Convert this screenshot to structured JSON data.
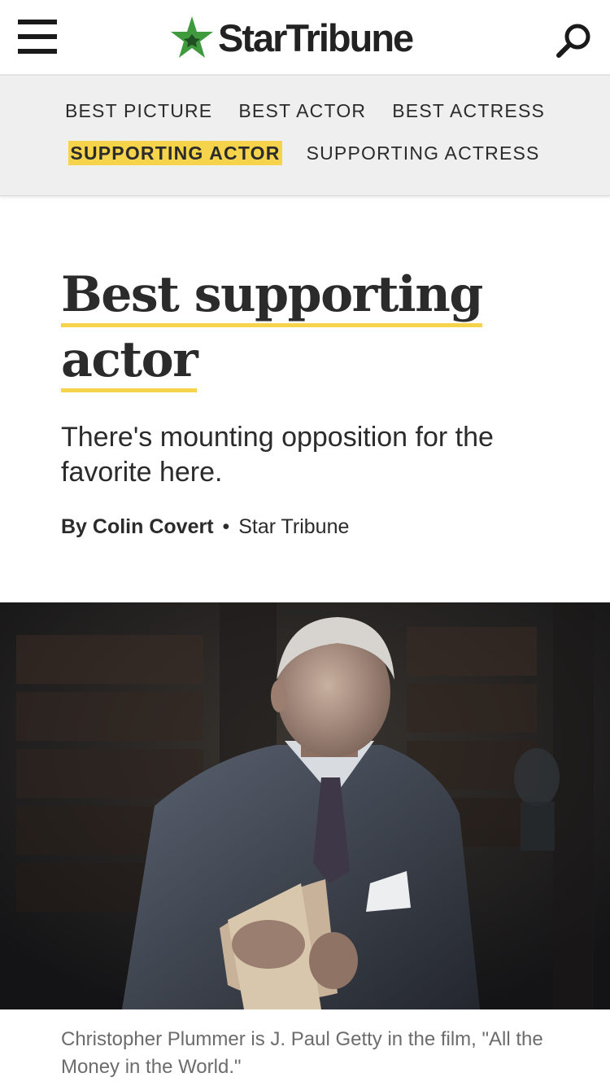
{
  "header": {
    "logo_text": "StarTribune",
    "brand_green": "#3f9a3e",
    "menu_icon": "hamburger-menu-icon",
    "search_icon": "search-icon"
  },
  "subnav": {
    "row1": [
      "BEST PICTURE",
      "BEST ACTOR",
      "BEST ACTRESS"
    ],
    "row2": [
      "SUPPORTING ACTOR",
      "SUPPORTING ACTRESS"
    ],
    "active": "SUPPORTING ACTOR",
    "highlight_color": "#f5d34a"
  },
  "article": {
    "headline_line1": "Best supporting",
    "headline_line2": "actor",
    "dek": "There's mounting opposition for the favorite here.",
    "byline_author": "By Colin Covert",
    "byline_separator": "•",
    "byline_outlet": "Star Tribune"
  },
  "photo": {
    "caption": "Christopher Plummer is J. Paul Getty in the film, \"All the Money in the World.\""
  }
}
